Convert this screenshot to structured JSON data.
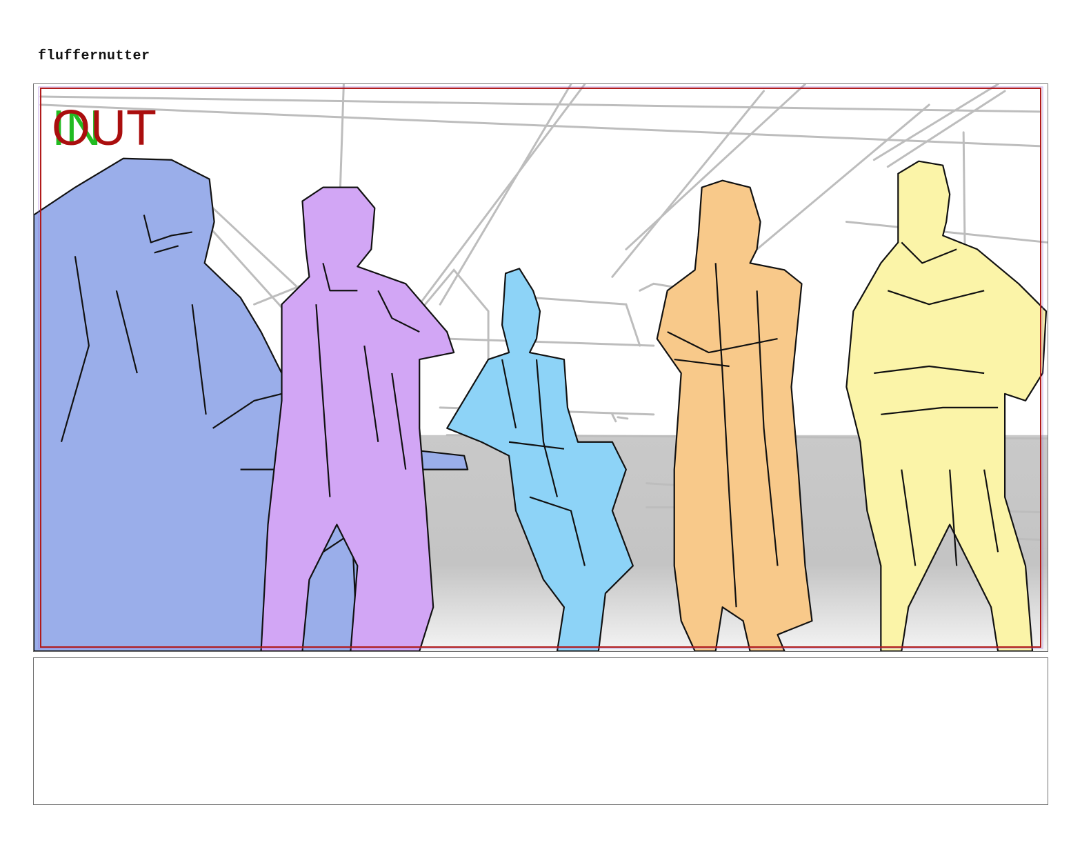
{
  "page": {
    "project_title": "fluffernutter"
  },
  "panel": {
    "in_label": "IN",
    "out_label": "OUT",
    "safe_frame_color": "#b01a1a",
    "characters": [
      {
        "id": "seated-swordsman",
        "color": "#9aaeea"
      },
      {
        "id": "horned-figure",
        "color": "#d2a6f5"
      },
      {
        "id": "topknot-figure",
        "color": "#8dd3f7"
      },
      {
        "id": "coat-figure",
        "color": "#f8c98a"
      },
      {
        "id": "elf-figure",
        "color": "#fbf4a8"
      }
    ],
    "background_colors": {
      "floor": "#c4c4c4",
      "lines": "#bdbdbd"
    }
  },
  "notes": {
    "text": ""
  }
}
